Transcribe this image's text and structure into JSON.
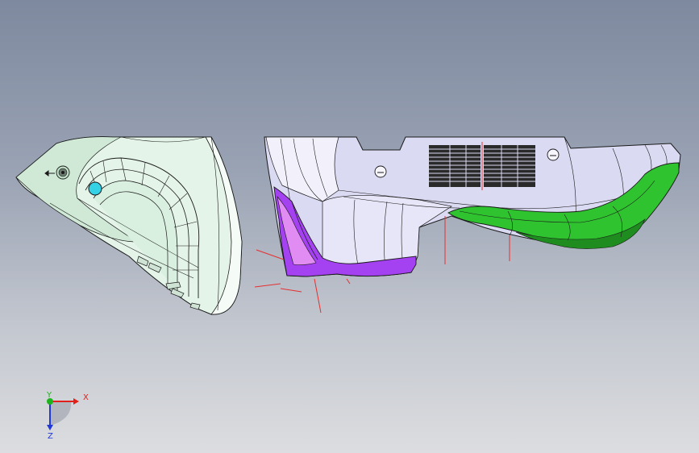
{
  "app": {
    "view": "cad-3d-viewport"
  },
  "triad": {
    "x_label": "X",
    "y_label": "Y",
    "z_label": "Z",
    "colors": {
      "x": "#e0211b",
      "y": "#1db31d",
      "z": "#2038d8"
    }
  },
  "model": {
    "colors": {
      "left_part": "#e3f3e7",
      "body": "#dcdcf2",
      "purple_pad": "#a441f0",
      "green_pad": "#2fc42f",
      "cyan_hole": "#35d2e6",
      "edges": "#1a1a1a",
      "center_lines": "#e53030"
    }
  }
}
